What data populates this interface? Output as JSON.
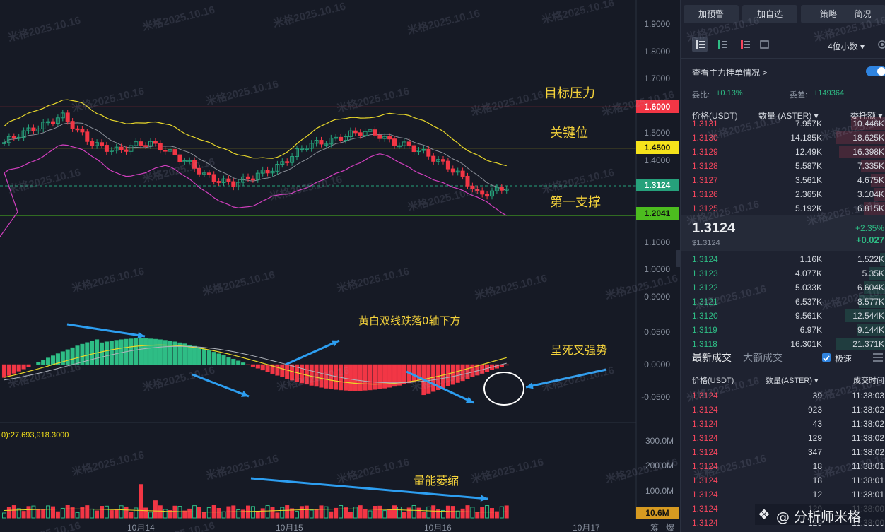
{
  "watermark": "米格2025.10.16",
  "price_axis": [
    "1.9000",
    "1.8000",
    "1.7000",
    "1.6000",
    "1.5000",
    "1.4500",
    "1.4000",
    "1.3124",
    "1.2041",
    "1.1000",
    "1.0000",
    "0.9000"
  ],
  "price_tags": {
    "target": "1.6000",
    "key": "1.4500",
    "current": "1.3124",
    "support": "1.2041"
  },
  "macd_axis": [
    "0.0500",
    "0.0000",
    "-0.0500"
  ],
  "volume_axis": [
    "300.0M",
    "200.0M",
    "100.0M"
  ],
  "volume_tag": "10.6M",
  "volume_label": "0):27,693,918.3000",
  "time_axis": [
    "10月14",
    "10月15",
    "10月16",
    "10月17"
  ],
  "bottom_icons": [
    "筹",
    "爆"
  ],
  "annotations": {
    "target": "目标压力",
    "key": "关键位",
    "support": "第一支撑",
    "macd_cross": "黄白双线跌落0轴下方",
    "death_cross": "呈死叉强势",
    "volume": "量能萎缩"
  },
  "brand": "@ 分析师米格",
  "panel": {
    "buttons": [
      "加预警",
      "加自选",
      "策略",
      "简况"
    ],
    "precision": "4位小数 ▾",
    "depth_link": "查看主力挂单情况 >",
    "ratio_label": "委比:",
    "ratio_value": "+0.13%",
    "diff_label": "委差:",
    "diff_value": "+149364",
    "col_price": "价格(USDT)",
    "col_qty": "数量 (ASTER) ▾",
    "col_amount": "委托额 ▾",
    "asks": [
      {
        "price": "1.3131",
        "qty": "7.957K",
        "amt": "10.446K",
        "w": 70
      },
      {
        "price": "1.3130",
        "qty": "14.185K",
        "amt": "18.625K",
        "w": 100
      },
      {
        "price": "1.3129",
        "qty": "12.49K",
        "amt": "16.398K",
        "w": 95
      },
      {
        "price": "1.3128",
        "qty": "5.587K",
        "amt": "7.335K",
        "w": 50
      },
      {
        "price": "1.3127",
        "qty": "3.561K",
        "amt": "4.675K",
        "w": 30
      },
      {
        "price": "1.3126",
        "qty": "2.365K",
        "amt": "3.104K",
        "w": 25
      },
      {
        "price": "1.3125",
        "qty": "5.192K",
        "amt": "6.815K",
        "w": 45
      }
    ],
    "last_price": "1.3124",
    "last_price_usd": "$1.3124",
    "change_pct": "+2.35%",
    "change_abs": "+0.027",
    "bids": [
      {
        "price": "1.3124",
        "qty": "1.16K",
        "amt": "1.522K",
        "w": 12
      },
      {
        "price": "1.3123",
        "qty": "4.077K",
        "amt": "5.35K",
        "w": 35
      },
      {
        "price": "1.3122",
        "qty": "5.033K",
        "amt": "6.604K",
        "w": 45
      },
      {
        "price": "1.3121",
        "qty": "6.537K",
        "amt": "8.577K",
        "w": 55
      },
      {
        "price": "1.3120",
        "qty": "9.561K",
        "amt": "12.544K",
        "w": 82
      },
      {
        "price": "1.3119",
        "qty": "6.97K",
        "amt": "9.144K",
        "w": 58
      },
      {
        "price": "1.3118",
        "qty": "16.301K",
        "amt": "21.371K",
        "w": 100
      }
    ],
    "trades_tab": "最新成交",
    "big_tab": "大额成交",
    "fast_label": "极速",
    "trade_col_price": "价格(USDT)",
    "trade_col_qty": "数量(ASTER) ▾",
    "trade_col_time": "成交时间",
    "trades": [
      {
        "price": "1.3124",
        "qty": "39",
        "time": "11:38:03"
      },
      {
        "price": "1.3124",
        "qty": "923",
        "time": "11:38:02"
      },
      {
        "price": "1.3124",
        "qty": "43",
        "time": "11:38:02"
      },
      {
        "price": "1.3124",
        "qty": "129",
        "time": "11:38:02"
      },
      {
        "price": "1.3124",
        "qty": "347",
        "time": "11:38:02"
      },
      {
        "price": "1.3124",
        "qty": "18",
        "time": "11:38:01"
      },
      {
        "price": "1.3124",
        "qty": "18",
        "time": "11:38:01"
      },
      {
        "price": "1.3124",
        "qty": "12",
        "time": "11:38:01"
      },
      {
        "price": "1.3124",
        "qty": "129",
        "time": "11:38:00"
      },
      {
        "price": "1.3124",
        "qty": "129",
        "time": "11:38:00"
      }
    ]
  }
}
